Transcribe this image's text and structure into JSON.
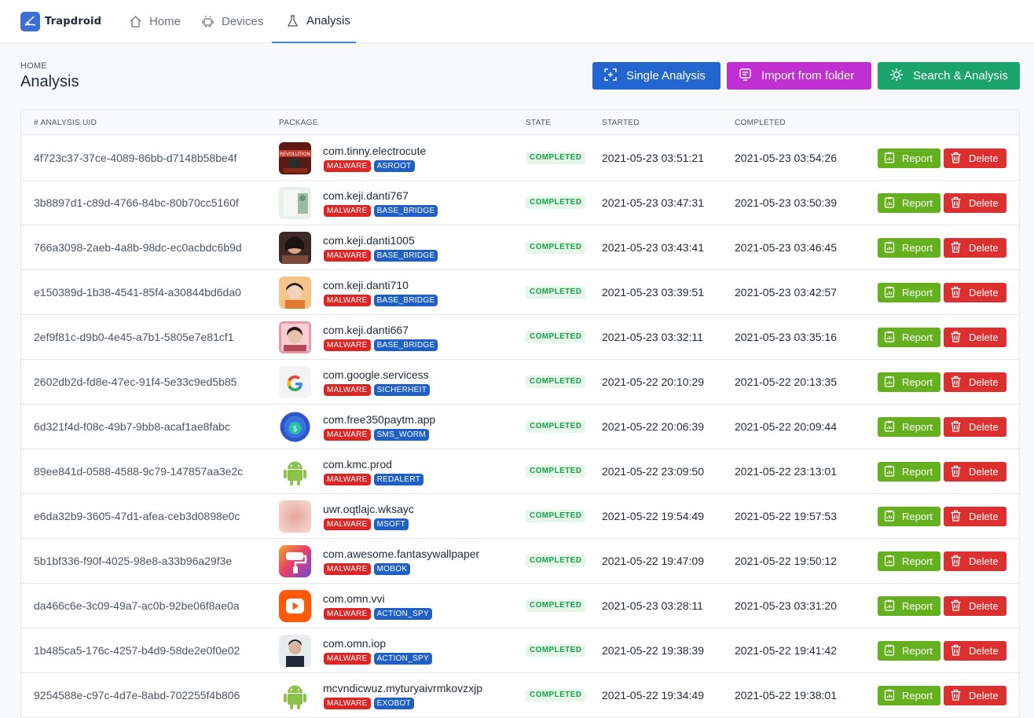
{
  "brand": {
    "name": "Trapdroid"
  },
  "nav": [
    {
      "label": "Home",
      "icon": "home-icon"
    },
    {
      "label": "Devices",
      "icon": "android-icon"
    },
    {
      "label": "Analysis",
      "icon": "flask-icon",
      "active": true
    }
  ],
  "breadcrumb": "HOME",
  "page_title": "Analysis",
  "actions": {
    "single": "Single Analysis",
    "import": "Import from folder",
    "search": "Search & Analysis"
  },
  "table": {
    "headers": [
      "# ANALYSIS UID",
      "PACKAGE",
      "STATE",
      "STARTED",
      "COMPLETED"
    ],
    "report_label": "Report",
    "delete_label": "Delete",
    "rows": [
      {
        "uid": "4f723c37-37ce-4089-86bb-d7148b58be4f",
        "package": "com.tinny.electrocute",
        "tags": [
          "MALWARE",
          "ASROOT"
        ],
        "state": "COMPLETED",
        "started": "2021-05-23 03:51:21",
        "completed": "2021-05-23 03:54:26",
        "icon": "app-icon-electrocute"
      },
      {
        "uid": "3b8897d1-c89d-4766-84bc-80b70cc5160f",
        "package": "com.keji.danti767",
        "tags": [
          "MALWARE",
          "BASE_BRIDGE"
        ],
        "state": "COMPLETED",
        "started": "2021-05-23 03:47:31",
        "completed": "2021-05-23 03:50:39",
        "icon": "app-icon-danti767"
      },
      {
        "uid": "766a3098-2aeb-4a8b-98dc-ec0acbdc6b9d",
        "package": "com.keji.danti1005",
        "tags": [
          "MALWARE",
          "BASE_BRIDGE"
        ],
        "state": "COMPLETED",
        "started": "2021-05-23 03:43:41",
        "completed": "2021-05-23 03:46:45",
        "icon": "app-icon-danti1005"
      },
      {
        "uid": "e150389d-1b38-4541-85f4-a30844bd6da0",
        "package": "com.keji.danti710",
        "tags": [
          "MALWARE",
          "BASE_BRIDGE"
        ],
        "state": "COMPLETED",
        "started": "2021-05-23 03:39:51",
        "completed": "2021-05-23 03:42:57",
        "icon": "app-icon-danti710"
      },
      {
        "uid": "2ef9f81c-d9b0-4e45-a7b1-5805e7e81cf1",
        "package": "com.keji.danti667",
        "tags": [
          "MALWARE",
          "BASE_BRIDGE"
        ],
        "state": "COMPLETED",
        "started": "2021-05-23 03:32:11",
        "completed": "2021-05-23 03:35:16",
        "icon": "app-icon-danti667"
      },
      {
        "uid": "2602db2d-fd8e-47ec-91f4-5e33c9ed5b85",
        "package": "com.google.servicess",
        "tags": [
          "MALWARE",
          "SICHERHEIT"
        ],
        "state": "COMPLETED",
        "started": "2021-05-22 20:10:29",
        "completed": "2021-05-22 20:13:35",
        "icon": "google-icon"
      },
      {
        "uid": "6d321f4d-f08c-49b7-9bb8-acaf1ae8fabc",
        "package": "com.free350paytm.app",
        "tags": [
          "MALWARE",
          "SMS_WORM"
        ],
        "state": "COMPLETED",
        "started": "2021-05-22 20:06:39",
        "completed": "2021-05-22 20:09:44",
        "icon": "coin-icon"
      },
      {
        "uid": "89ee841d-0588-4588-9c79-147857aa3e2c",
        "package": "com.kmc.prod",
        "tags": [
          "MALWARE",
          "REDALERT"
        ],
        "state": "COMPLETED",
        "started": "2021-05-22 23:09:50",
        "completed": "2021-05-22 23:13:01",
        "icon": "android-robot-icon"
      },
      {
        "uid": "e6da32b9-3605-47d1-afea-ceb3d0898e0c",
        "package": "uwr.oqtlajc.wksayc",
        "tags": [
          "MALWARE",
          "MSOFT"
        ],
        "state": "COMPLETED",
        "started": "2021-05-22 19:54:49",
        "completed": "2021-05-22 19:57:53",
        "icon": "blurred-app-icon"
      },
      {
        "uid": "5b1bf336-f90f-4025-98e8-a33b96a29f3e",
        "package": "com.awesome.fantasywallpaper",
        "tags": [
          "MALWARE",
          "MOBOK"
        ],
        "state": "COMPLETED",
        "started": "2021-05-22 19:47:09",
        "completed": "2021-05-22 19:50:12",
        "icon": "paint-roller-icon"
      },
      {
        "uid": "da466c6e-3c09-49a7-ac0b-92be06f8ae0a",
        "package": "com.omn.vvi",
        "tags": [
          "MALWARE",
          "ACTION_SPY"
        ],
        "state": "COMPLETED",
        "started": "2021-05-23 03:28:11",
        "completed": "2021-05-23 03:31:20",
        "icon": "play-icon"
      },
      {
        "uid": "1b485ca5-176c-4257-b4d9-58de2e0f0e02",
        "package": "com.omn.iop",
        "tags": [
          "MALWARE",
          "ACTION_SPY"
        ],
        "state": "COMPLETED",
        "started": "2021-05-22 19:38:39",
        "completed": "2021-05-22 19:41:42",
        "icon": "portrait-app-icon"
      },
      {
        "uid": "9254588e-c97c-4d7e-8abd-702255f4b806",
        "package": "mcvndicwuz.myturyaivrmkovzxjp",
        "tags": [
          "MALWARE",
          "EXOBOT"
        ],
        "state": "COMPLETED",
        "started": "2021-05-22 19:34:49",
        "completed": "2021-05-22 19:38:01",
        "icon": "android-robot-icon"
      }
    ]
  },
  "colors": {
    "primary": "#2366cf",
    "import": "#c02fd1",
    "search": "#1aa36a",
    "report": "#65b01f",
    "delete": "#dc3030",
    "malware_tag": "#dc2626",
    "family_tag": "#2060c6",
    "state_text": "#16a34a"
  }
}
